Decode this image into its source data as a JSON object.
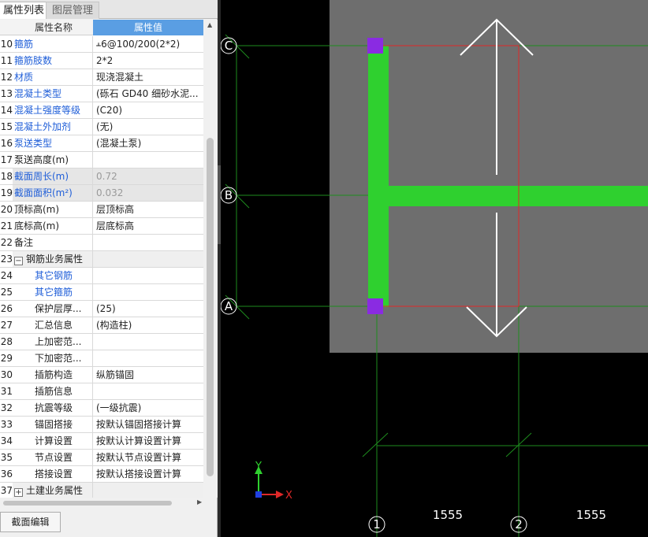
{
  "tabs": [
    {
      "label": "属性列表"
    },
    {
      "label": "图层管理"
    }
  ],
  "grid": {
    "header": {
      "name": "属性名称",
      "value": "属性值"
    },
    "rows": [
      {
        "num": "10",
        "name": "箍筋",
        "value": "ⲳ6@100/200(2*2)"
      },
      {
        "num": "11",
        "name": "箍筋肢数",
        "value": "2*2"
      },
      {
        "num": "12",
        "name": "材质",
        "value": "现浇混凝土"
      },
      {
        "num": "13",
        "name": "混凝土类型",
        "value": "(砾石 GD40 细砂水泥..."
      },
      {
        "num": "14",
        "name": "混凝土强度等级",
        "value": "(C20)"
      },
      {
        "num": "15",
        "name": "混凝土外加剂",
        "value": "(无)"
      },
      {
        "num": "16",
        "name": "泵送类型",
        "value": "(混凝土泵)"
      },
      {
        "num": "17",
        "name": "泵送高度(m)",
        "value": ""
      },
      {
        "num": "18",
        "name": "截面周长(m)",
        "value": "0.72"
      },
      {
        "num": "19",
        "name": "截面面积(m²)",
        "value": "0.032"
      },
      {
        "num": "20",
        "name": "顶标高(m)",
        "value": "层顶标高"
      },
      {
        "num": "21",
        "name": "底标高(m)",
        "value": "层底标高"
      },
      {
        "num": "22",
        "name": "备注",
        "value": ""
      },
      {
        "num": "23",
        "name": "钢筋业务属性",
        "value": "",
        "toggle": "−"
      },
      {
        "num": "24",
        "name": "其它钢筋",
        "value": ""
      },
      {
        "num": "25",
        "name": "其它箍筋",
        "value": ""
      },
      {
        "num": "26",
        "name": "保护层厚...",
        "value": "(25)"
      },
      {
        "num": "27",
        "name": "汇总信息",
        "value": "(构造柱)"
      },
      {
        "num": "28",
        "name": "上加密范...",
        "value": ""
      },
      {
        "num": "29",
        "name": "下加密范...",
        "value": ""
      },
      {
        "num": "30",
        "name": "插筋构造",
        "value": "纵筋锚固"
      },
      {
        "num": "31",
        "name": "插筋信息",
        "value": ""
      },
      {
        "num": "32",
        "name": "抗震等级",
        "value": "(一级抗震)"
      },
      {
        "num": "33",
        "name": "锚固搭接",
        "value": "按默认锚固搭接计算"
      },
      {
        "num": "34",
        "name": "计算设置",
        "value": "按默认计算设置计算"
      },
      {
        "num": "35",
        "name": "节点设置",
        "value": "按默认节点设置计算"
      },
      {
        "num": "36",
        "name": "搭接设置",
        "value": "按默认搭接设置计算"
      },
      {
        "num": "37",
        "name": "土建业务属性",
        "value": "",
        "toggle": "+"
      }
    ]
  },
  "buttons": {
    "section_edit": "截面编辑"
  },
  "canvas": {
    "axis_labels": {
      "c": "C",
      "b": "B",
      "a": "A",
      "one": "1",
      "two": "2"
    },
    "dimensions": [
      "1555",
      "1555"
    ],
    "ucs": {
      "x": "X",
      "y": "Y"
    },
    "colors": {
      "background": "#000000",
      "slab": "#6e6e6e",
      "beam": "#2fd02f",
      "grid": "#1e8c1e",
      "column": "#8a2be2",
      "red_line": "#e02828",
      "arrow": "#ffffff"
    }
  }
}
